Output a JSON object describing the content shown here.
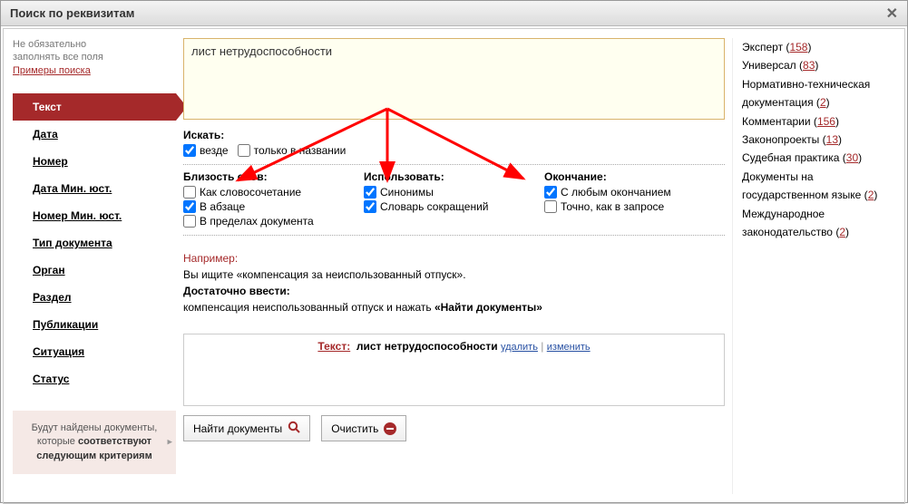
{
  "window": {
    "title": "Поиск по реквизитам"
  },
  "left": {
    "hint_line1": "Не обязательно",
    "hint_line2": "заполнять все поля",
    "hint_link": "Примеры поиска",
    "nav": [
      "Текст",
      "Дата",
      "Номер",
      "Дата Мин. юст.",
      "Номер Мин. юст.",
      "Тип документа",
      "Орган",
      "Раздел",
      "Публикации",
      "Ситуация",
      "Статус"
    ],
    "info_prefix": "Будут найдены документы, которые ",
    "info_bold": "соответствуют следующим критериям"
  },
  "middle": {
    "query": "лист нетрудоспособности",
    "search_in_label": "Искать:",
    "search_in": {
      "everywhere": "везде",
      "title_only": "только в названии"
    },
    "proximity_label": "Близость слов:",
    "proximity": {
      "phrase": "Как словосочетание",
      "paragraph": "В абзаце",
      "document": "В пределах документа"
    },
    "use_label": "Использовать:",
    "use": {
      "synonyms": "Синонимы",
      "abbrev": "Словарь сокращений"
    },
    "ending_label": "Окончание:",
    "ending": {
      "any": "С любым окончанием",
      "exact": "Точно, как в запросе"
    },
    "example_header": "Например:",
    "example_line1": "Вы ищите «компенсация за неиспользованный отпуск».",
    "enough_label": "Достаточно ввести:",
    "example_line2_a": "компенсация неиспользованный отпуск и нажать ",
    "example_line2_b": "«Найти документы»",
    "criteria": {
      "label": "Текст:",
      "value": "лист нетрудоспособности",
      "delete": "удалить",
      "edit": "изменить"
    },
    "btn_find": "Найти документы",
    "btn_clear": "Очистить"
  },
  "right": [
    {
      "name": "Эксперт",
      "count": "158"
    },
    {
      "name": "Универсал",
      "count": "83"
    },
    {
      "name": "Нормативно-техническая документация",
      "count": "2"
    },
    {
      "name": "Комментарии",
      "count": "156"
    },
    {
      "name": "Законопроекты",
      "count": "13"
    },
    {
      "name": "Судебная практика",
      "count": "30"
    },
    {
      "name": "Документы на государственном языке",
      "count": "2"
    },
    {
      "name": "Международное законодательство",
      "count": "2"
    }
  ]
}
